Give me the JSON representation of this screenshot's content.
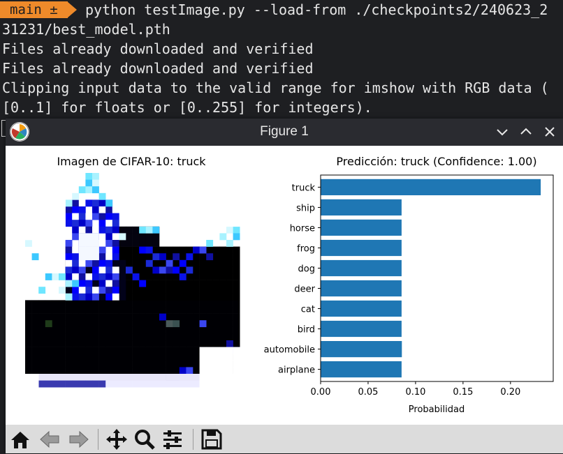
{
  "terminal": {
    "prompt_label": "main ±",
    "command_line1": "python testImage.py --load-from ./checkpoints2/240623_2",
    "command_line2": "31231/best_model.pth",
    "output_line1": "Files already downloaded and verified",
    "output_line2": "Files already downloaded and verified",
    "output_line3": "Clipping input data to the valid range for imshow with RGB data (",
    "output_line4": "[0..1] for floats or [0..255] for integers).",
    "colors": {
      "background": "#1e1f22",
      "text": "#e6e6e6",
      "prompt_badge": "#ee8a2a"
    }
  },
  "window": {
    "title": "Figure 1",
    "controls": [
      "chevron-down-icon",
      "chevron-up-icon",
      "close-icon"
    ],
    "toolbar_icons": [
      "home-icon",
      "back-arrow-icon",
      "forward-arrow-icon",
      "move-icon",
      "zoom-icon",
      "configure-subplots-icon",
      "save-icon"
    ]
  },
  "image_panel": {
    "title": "Imagen de CIFAR-10: truck"
  },
  "chart_data": {
    "type": "bar",
    "orientation": "horizontal",
    "title": "Predicción: truck (Confidence: 1.00)",
    "xlabel": "Probabilidad",
    "ylabel": "",
    "categories": [
      "airplane",
      "automobile",
      "bird",
      "cat",
      "deer",
      "dog",
      "frog",
      "horse",
      "ship",
      "truck"
    ],
    "values": [
      0.0853,
      0.0856,
      0.0853,
      0.0853,
      0.0853,
      0.0853,
      0.0853,
      0.0853,
      0.0853,
      0.2318
    ],
    "xlim": [
      0.0,
      0.245
    ],
    "xticks": [
      "0.00",
      "0.05",
      "0.10",
      "0.15",
      "0.20"
    ],
    "xtick_values": [
      0.0,
      0.05,
      0.1,
      0.15,
      0.2
    ],
    "bar_color": "#1f77b4",
    "grid": false
  }
}
